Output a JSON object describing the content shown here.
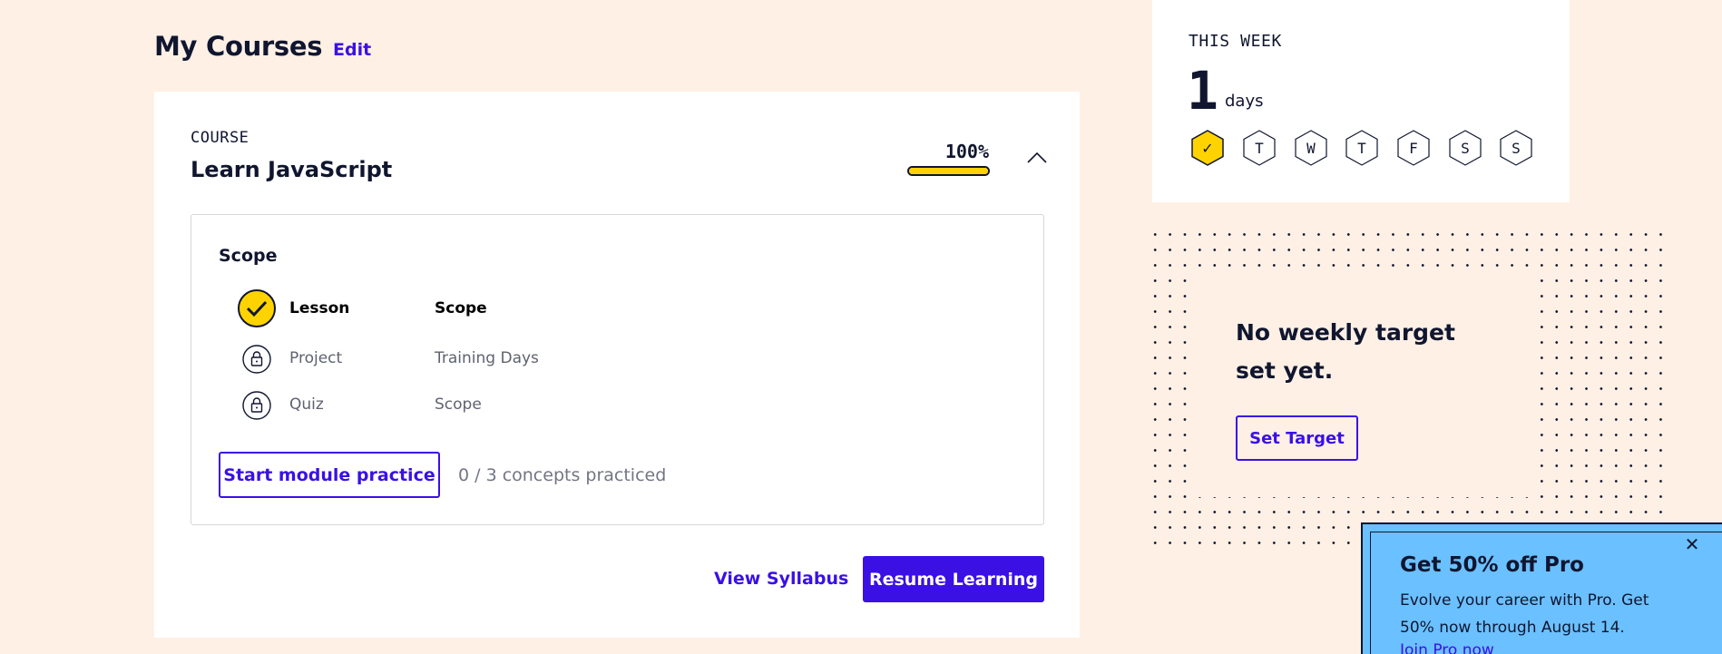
{
  "header": {
    "title": "My Courses",
    "edit_label": "Edit"
  },
  "course": {
    "eyebrow": "COURSE",
    "name": "Learn JavaScript",
    "progress_label": "100%",
    "progress_fraction": 1.0,
    "module": {
      "title": "Scope",
      "items": [
        {
          "type": "Lesson",
          "title": "Scope",
          "status": "completed",
          "icon": "check-circle-icon"
        },
        {
          "type": "Project",
          "title": "Training Days",
          "status": "locked",
          "icon": "lock-icon"
        },
        {
          "type": "Quiz",
          "title": "Scope",
          "status": "locked",
          "icon": "lock-icon"
        }
      ],
      "practice_button": "Start module practice",
      "concepts_text": "0 / 3 concepts practiced"
    },
    "view_syllabus": "View Syllabus",
    "resume_button": "Resume Learning"
  },
  "week": {
    "label": "THIS WEEK",
    "count": "1",
    "unit": "days",
    "days": [
      {
        "label": "✓",
        "completed": true
      },
      {
        "label": "T",
        "completed": false
      },
      {
        "label": "W",
        "completed": false
      },
      {
        "label": "T",
        "completed": false
      },
      {
        "label": "F",
        "completed": false
      },
      {
        "label": "S",
        "completed": false
      },
      {
        "label": "S",
        "completed": false
      }
    ]
  },
  "target": {
    "text": "No weekly target set yet.",
    "button": "Set Target"
  },
  "promo": {
    "title": "Get 50% off Pro",
    "body": "Evolve your career with Pro. Get 50% now through August 14.",
    "link": "Join Pro now",
    "close": "✕"
  },
  "colors": {
    "background": "#fff0e5",
    "accent": "#3a10e5",
    "yellow": "#ffd300",
    "navy": "#10162f",
    "promo": "#6bc0ff"
  }
}
